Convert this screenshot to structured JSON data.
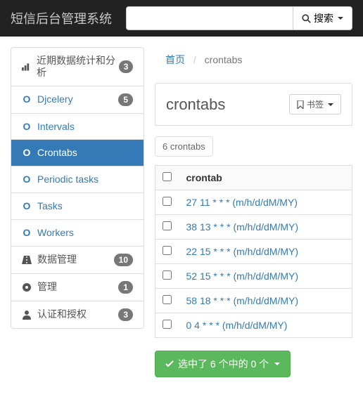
{
  "brand": "短信后台管理系统",
  "search": {
    "placeholder": "",
    "button": "搜索"
  },
  "sidebar": {
    "stats": {
      "label": "近期数据统计和分析",
      "badge": "3"
    },
    "djcelery": {
      "label": "Djcelery",
      "badge": "5"
    },
    "intervals": {
      "label": "Intervals"
    },
    "crontabs": {
      "label": "Crontabs"
    },
    "ptasks": {
      "label": "Periodic tasks"
    },
    "tasks": {
      "label": "Tasks"
    },
    "workers": {
      "label": "Workers"
    },
    "datamgmt": {
      "label": "数据管理",
      "badge": "10"
    },
    "admin": {
      "label": "管理",
      "badge": "1"
    },
    "auth": {
      "label": "认证和授权",
      "badge": "3"
    }
  },
  "breadcrumb": {
    "home": "首页",
    "current": "crontabs"
  },
  "page": {
    "title": "crontabs",
    "bookmark": "书签"
  },
  "count": "6 crontabs",
  "table": {
    "header": "crontab",
    "rows": [
      "27 11 * * * (m/h/d/dM/MY)",
      "38 13 * * * (m/h/d/dM/MY)",
      "22 15 * * * (m/h/d/dM/MY)",
      "52 15 * * * (m/h/d/dM/MY)",
      "58 18 * * * (m/h/d/dM/MY)",
      "0 4 * * * (m/h/d/dM/MY)"
    ]
  },
  "selected": "选中了 6 个中的 0 个"
}
